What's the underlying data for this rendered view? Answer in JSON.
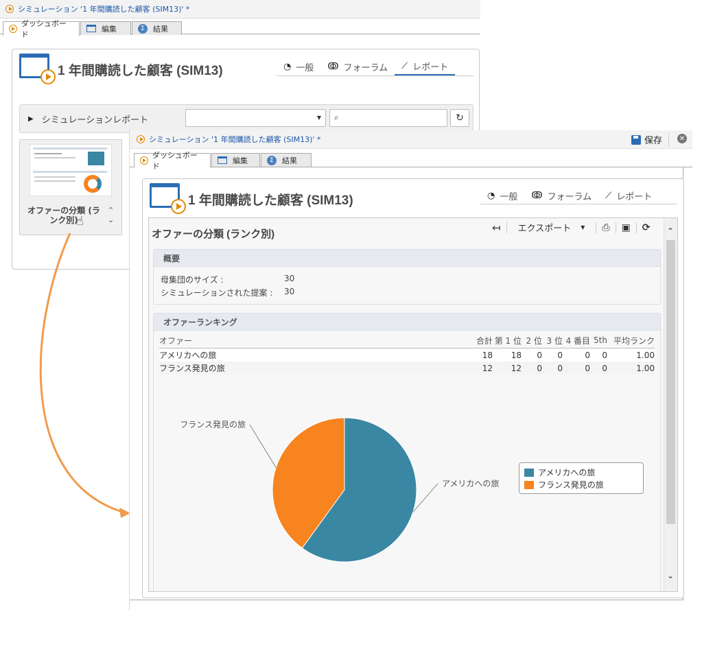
{
  "back_window": {
    "title": "シミュレーション '1 年間購読した顧客 (SIM13)' *",
    "tabs": [
      {
        "label": "ダッシュボード"
      },
      {
        "label": "編集"
      },
      {
        "label": "結果"
      }
    ],
    "heading": "1 年間購読した顧客 (SIM13)",
    "view_tabs": [
      {
        "label": "一般"
      },
      {
        "label": "フォーラム"
      },
      {
        "label": "レポート"
      }
    ],
    "report_bar_label": "シミュレーションレポート",
    "tile_label": "オファーの分類 (ランク別)"
  },
  "front_window": {
    "title": "シミュレーション '1 年間購読した顧客 (SIM13)' *",
    "save_label": "保存",
    "tabs": [
      {
        "label": "ダッシュボード"
      },
      {
        "label": "編集"
      },
      {
        "label": "結果"
      }
    ],
    "heading": "1 年間購読した顧客 (SIM13)",
    "view_tabs": [
      {
        "label": "一般"
      },
      {
        "label": "フォーラム"
      },
      {
        "label": "レポート"
      }
    ],
    "report": {
      "title": "オファーの分類 (ランク別)",
      "export_label": "エクスポート",
      "summary": {
        "heading": "概要",
        "rows": [
          {
            "label": "母集団のサイズ :",
            "value": "30"
          },
          {
            "label": "シミュレーションされた提案 :",
            "value": "30"
          }
        ]
      },
      "ranking": {
        "heading": "オファーランキング",
        "columns": [
          "オファー",
          "合計",
          "第 1 位",
          "2 位",
          "3 位",
          "4 番目",
          "5th",
          "平均ランク"
        ],
        "rows": [
          [
            "アメリカへの旅",
            "18",
            "18",
            "0",
            "0",
            "0",
            "0",
            "1.00"
          ],
          [
            "フランス発見の旅",
            "12",
            "12",
            "0",
            "0",
            "0",
            "0",
            "1.00"
          ]
        ]
      }
    }
  },
  "colors": {
    "teal": "#3a87a3",
    "orange": "#f7841f",
    "link_blue": "#1a56a8",
    "accent_blue": "#2b6db5",
    "arrow_orange": "#f29a4a"
  },
  "chart_data": {
    "type": "pie",
    "categories": [
      "アメリカへの旅",
      "フランス発見の旅"
    ],
    "values": [
      18,
      12
    ],
    "colors": [
      "#3a87a3",
      "#f7841f"
    ],
    "legend": "right"
  }
}
